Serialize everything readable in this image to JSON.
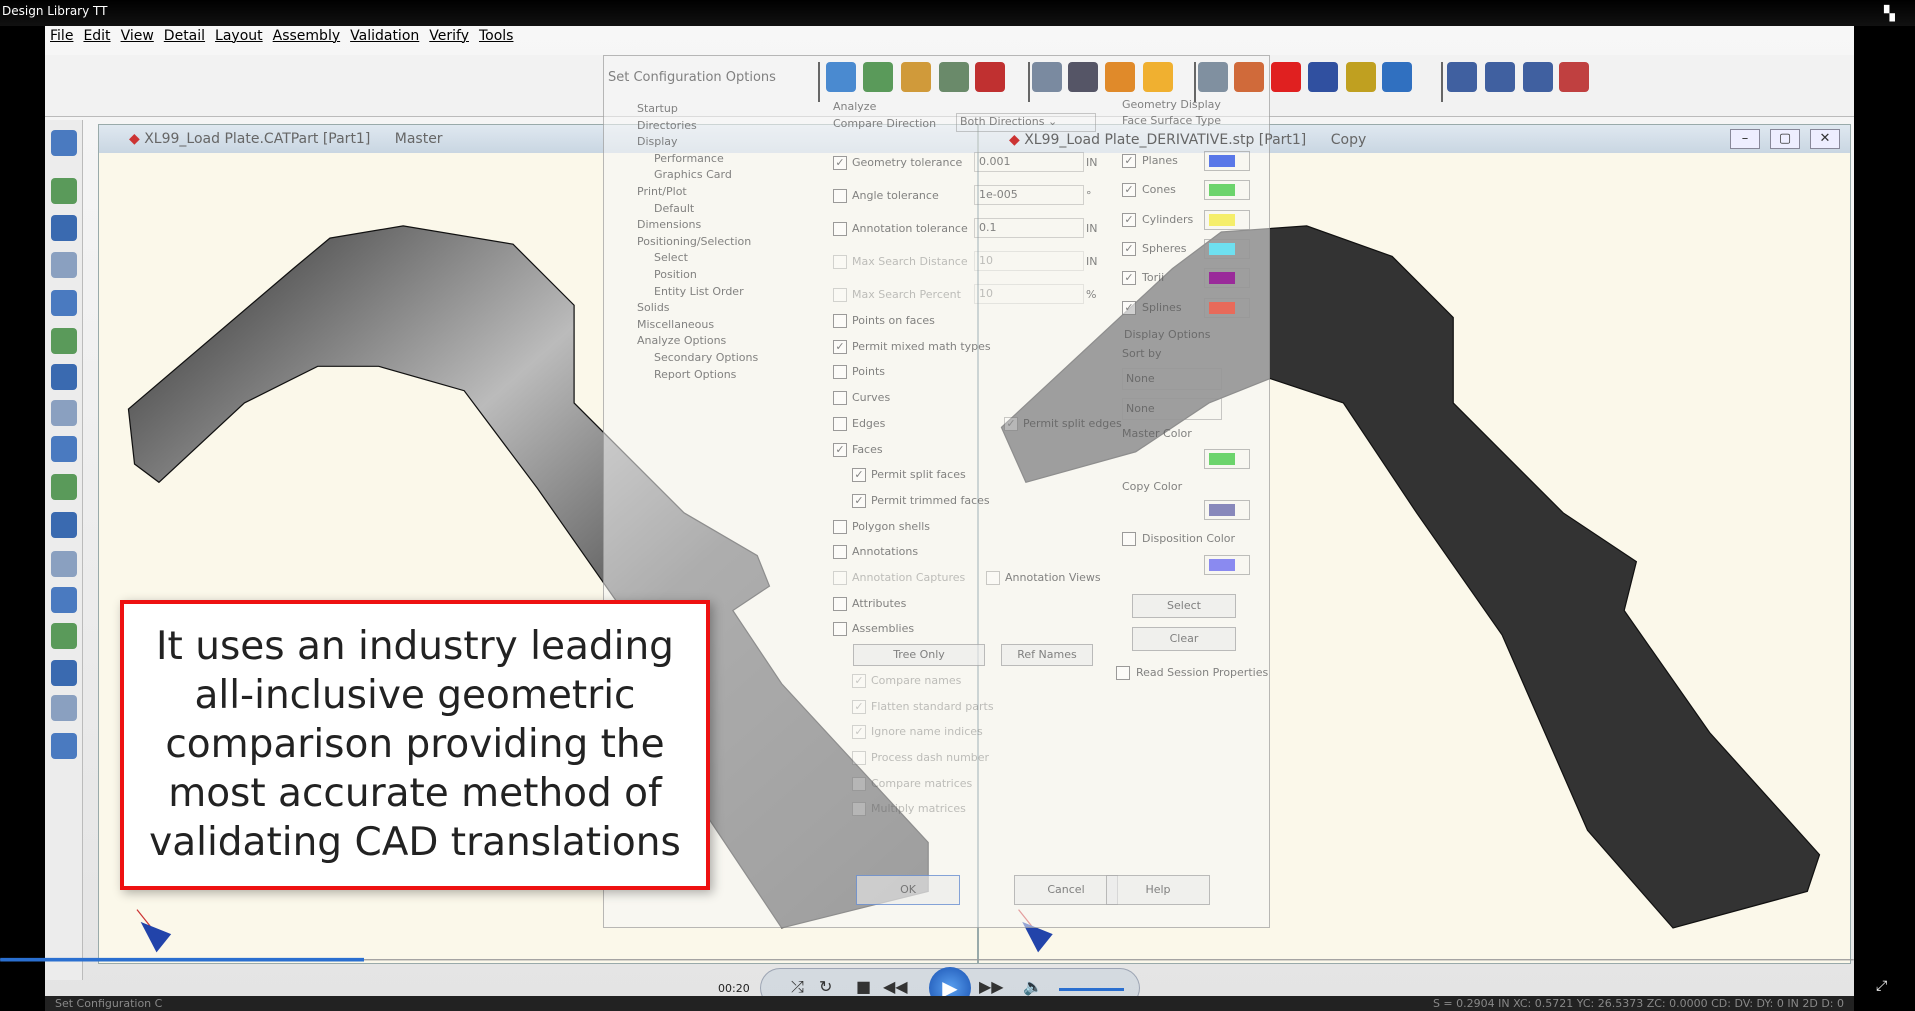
{
  "title": "Design Library TT",
  "menu": [
    "File",
    "Edit",
    "View",
    "Detail",
    "Layout",
    "Assembly",
    "Validation",
    "Verify",
    "Tools"
  ],
  "master_window": {
    "title": "XL99_Load Plate.CATPart [Part1]",
    "role": "Master"
  },
  "copy_window": {
    "title": "XL99_Load Plate_DERIVATIVE.stp [Part1]",
    "role": "Copy"
  },
  "dialog": {
    "title": "Set Configuration Options",
    "tree": [
      [
        "Startup",
        0
      ],
      [
        "Directories",
        0
      ],
      [
        "Display",
        0
      ],
      [
        "Performance",
        1
      ],
      [
        "Graphics Card",
        1
      ],
      [
        "Print/Plot",
        0
      ],
      [
        "Default",
        1
      ],
      [
        "Dimensions",
        0
      ],
      [
        "Positioning/Selection",
        0
      ],
      [
        "Select",
        1
      ],
      [
        "Position",
        1
      ],
      [
        "Entity List Order",
        1
      ],
      [
        "Solids",
        0
      ],
      [
        "Miscellaneous",
        0
      ],
      [
        "Analyze Options",
        0
      ],
      [
        "Secondary Options",
        1
      ],
      [
        "Report Options",
        1
      ]
    ],
    "analyze_label": "Analyze",
    "compare_direction_label": "Compare Direction",
    "compare_direction_value": "Both Directions",
    "rows": [
      {
        "label": "Geometry tolerance",
        "checked": true,
        "value": "0.001",
        "unit": "IN"
      },
      {
        "label": "Angle tolerance",
        "checked": false,
        "value": "1e-005",
        "unit": "°"
      },
      {
        "label": "Annotation tolerance",
        "checked": false,
        "value": "0.1",
        "unit": "IN"
      },
      {
        "label": "Max Search Distance",
        "checked": false,
        "disabled": true,
        "value": "10",
        "unit": "IN"
      },
      {
        "label": "Max Search Percent",
        "checked": false,
        "disabled": true,
        "value": "10",
        "unit": "%"
      },
      {
        "label": "Points on faces",
        "checked": false
      },
      {
        "label": "Permit mixed math types",
        "checked": true
      },
      {
        "label": "Points",
        "checked": false
      },
      {
        "label": "Curves",
        "checked": false
      },
      {
        "label": "Edges",
        "checked": false,
        "extra": "Permit split edges"
      },
      {
        "label": "Faces",
        "checked": true
      },
      {
        "label": "Permit split faces",
        "checked": true,
        "indent": true
      },
      {
        "label": "Permit trimmed faces",
        "checked": true,
        "indent": true
      },
      {
        "label": "Polygon shells",
        "checked": false
      },
      {
        "label": "Annotations",
        "checked": false
      },
      {
        "label": "Annotation Captures",
        "checked": false,
        "disabled": true,
        "extra": "Annotation Views"
      },
      {
        "label": "Attributes",
        "checked": false
      },
      {
        "label": "Assemblies",
        "checked": false
      },
      {
        "label": "",
        "buttons": [
          "Tree Only",
          "Ref Names"
        ]
      },
      {
        "label": "Compare names",
        "checked": true,
        "indent": true,
        "disabled": true
      },
      {
        "label": "Flatten standard parts",
        "checked": true,
        "indent": true,
        "disabled": true
      },
      {
        "label": "Ignore name indices",
        "checked": true,
        "indent": true,
        "disabled": true
      },
      {
        "label": "Process dash number",
        "checked": false,
        "indent": true,
        "disabled": true
      },
      {
        "label": "Compare matrices",
        "checked": false,
        "indent": true,
        "disabled": true
      },
      {
        "label": "Multiply matrices",
        "checked": false,
        "indent": true,
        "disabled": true
      }
    ],
    "geometry_display_label": "Geometry Display",
    "face_surface_type_label": "Face Surface Type",
    "surfaces": [
      {
        "label": "Planes",
        "color": "#5a78e8"
      },
      {
        "label": "Cones",
        "color": "#6cd46c"
      },
      {
        "label": "Cylinders",
        "color": "#f5ee6a"
      },
      {
        "label": "Spheres",
        "color": "#6ee0f0"
      },
      {
        "label": "Torii",
        "color": "#9a2a9a"
      },
      {
        "label": "Splines",
        "color": "#e86a5a"
      }
    ],
    "display_options_label": "Display Options",
    "sort_by_label": "Sort by",
    "sort_values": [
      "None",
      "None"
    ],
    "master_color_label": "Master Color",
    "master_color": "#6cd46c",
    "copy_color_label": "Copy Color",
    "copy_color": "#8888bb",
    "disposition_color_label": "Disposition Color",
    "disposition_color": "#8a8af0",
    "select_label": "Select",
    "clear_label": "Clear",
    "read_session_label": "Read Session Properties",
    "ok_label": "OK",
    "cancel_label": "Cancel",
    "help_label": "Help"
  },
  "callout_text": "It uses an industry leading all-inclusive geometric comparison providing the most accurate method of validating CAD translations",
  "player": {
    "time": "00:20",
    "progress_percent": 19
  },
  "status_left": "Set Configuration C",
  "status_right": "S = 0.2904 IN  XC: 0.5721  YC: 26.5373  ZC: 0.0000   CD: DV: DY: 0   IN   2D  D: 0"
}
